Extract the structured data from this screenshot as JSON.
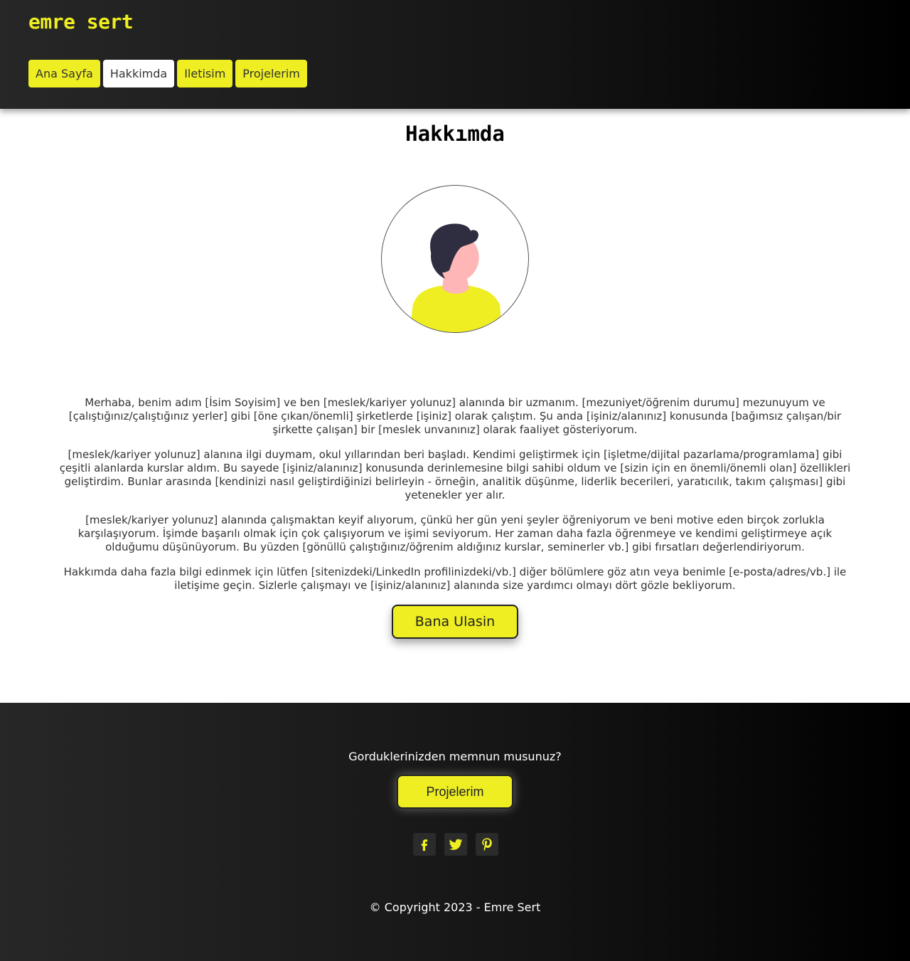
{
  "header": {
    "brand": "emre sert",
    "nav": [
      {
        "label": "Ana Sayfa",
        "active": false
      },
      {
        "label": "Hakkimda",
        "active": true
      },
      {
        "label": "Iletisim",
        "active": false
      },
      {
        "label": "Projelerim",
        "active": false
      }
    ]
  },
  "main": {
    "title": "Hakkımda",
    "avatar_icon": "person-avatar",
    "paragraphs": [
      "Merhaba, benim adım [İsim Soyisim] ve ben [meslek/kariyer yolunuz] alanında bir uzmanım. [mezuniyet/öğrenim durumu] mezunuyum ve [çalıştığınız/çalıştığınız yerler] gibi [öne çıkan/önemli] şirketlerde [işiniz] olarak çalıştım. Şu anda [işiniz/alanınız] konusunda [bağımsız çalışan/bir şirkette çalışan] bir [meslek unvanınız] olarak faaliyet gösteriyorum.",
      "[meslek/kariyer yolunuz] alanına ilgi duymam, okul yıllarından beri başladı. Kendimi geliştirmek için [işletme/dijital pazarlama/programlama] gibi çeşitli alanlarda kurslar aldım. Bu sayede [işiniz/alanınız] konusunda derinlemesine bilgi sahibi oldum ve [sizin için en önemli/önemli olan] özellikleri geliştirdim. Bunlar arasında [kendinizi nasıl geliştirdiğinizi belirleyin - örneğin, analitik düşünme, liderlik becerileri, yaratıcılık, takım çalışması] gibi yetenekler yer alır.",
      "[meslek/kariyer yolunuz] alanında çalışmaktan keyif alıyorum, çünkü her gün yeni şeyler öğreniyorum ve beni motive eden birçok zorlukla karşılaşıyorum. İşimde başarılı olmak için çok çalışıyorum ve işimi seviyorum. Her zaman daha fazla öğrenmeye ve kendimi geliştirmeye açık olduğumu düşünüyorum. Bu yüzden [gönüllü çalıştığınız/öğrenim aldığınız kurslar, seminerler vb.] gibi fırsatları değerlendiriyorum.",
      "Hakkımda daha fazla bilgi edinmek için lütfen [sitenizdeki/LinkedIn profilinizdeki/vb.] diğer bölümlere göz atın veya benimle [e-posta/adres/vb.] ile iletişime geçin. Sizlerle çalışmayı ve [işiniz/alanınız] alanında size yardımcı olmayı dört gözle bekliyorum."
    ],
    "cta_label": "Bana Ulasin"
  },
  "footer": {
    "question": "Gorduklerinizden memnun musunuz?",
    "button_label": "Projelerim",
    "socials": [
      "facebook-icon",
      "twitter-icon",
      "pinterest-icon"
    ],
    "copyright": "© Copyright 2023 - Emre Sert"
  },
  "colors": {
    "accent": "#eeee22",
    "dark": "#000000",
    "avatar_hair": "#2f2e41",
    "avatar_skin": "#ffb6b6"
  }
}
